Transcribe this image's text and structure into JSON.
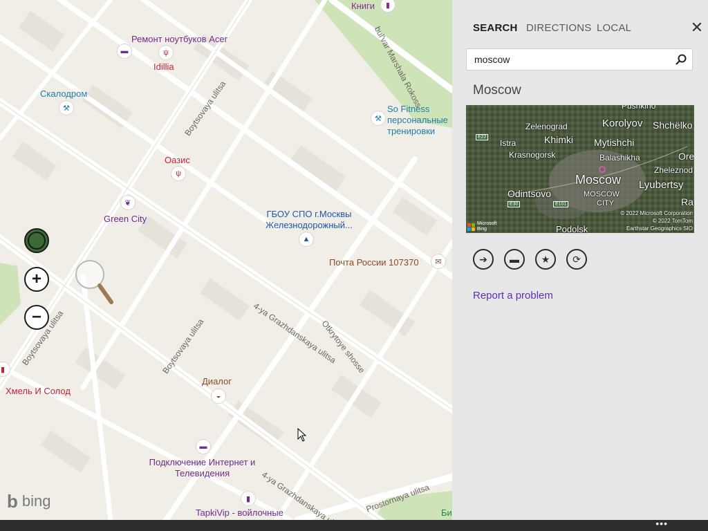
{
  "tabs": [
    "SEARCH",
    "DIRECTIONS",
    "LOCAL"
  ],
  "search": {
    "value": "moscow"
  },
  "result": {
    "title": "Moscow",
    "report_link": "Report a problem",
    "thumbnail": {
      "places": [
        "Pushkino",
        "Zelenograd",
        "Korolyov",
        "Shchëlko",
        "Khimki",
        "Mytishchi",
        "Istra",
        "Krasnogorsk",
        "Balashikha",
        "Ore",
        "Zheleznod",
        "Moscow",
        "Odintsovo",
        "Lyubertsy",
        "MOSCOW",
        "CITY",
        "Ra",
        "Podolsk"
      ],
      "route_shields": [
        "E22",
        "E30",
        "E101"
      ],
      "credits": [
        "© 2022 Microsoft Corporation",
        "© 2022 TomTom",
        "Earthstar Geographics SIO"
      ],
      "logo": [
        "Microsoft",
        "Bing"
      ]
    }
  },
  "map": {
    "poi": [
      {
        "label": "Книги",
        "icon": "book-icon",
        "color": "#8a2e8e"
      },
      {
        "label": "Ремонт ноутбуков Acer",
        "icon": "laptop-icon",
        "color": "#6d2b8c"
      },
      {
        "label": "Idillia",
        "icon": "restaurant-icon",
        "color": "#c0233a"
      },
      {
        "label": "Скалодром",
        "icon": "fitness-icon",
        "color": "#1d7ea8"
      },
      {
        "label": "So Fitness персональные тренировки",
        "icon": "fitness-icon",
        "color": "#1d7ea8"
      },
      {
        "label": "Оазис",
        "icon": "restaurant-icon",
        "color": "#c0233a"
      },
      {
        "label": "Green City",
        "icon": "leaf-icon",
        "color": "#6d2b8c"
      },
      {
        "label": "ГБОУ СПО г.Москвы Железнодорожный...",
        "icon": "school-icon",
        "color": "#1f55a8"
      },
      {
        "label": "Почта России 107370",
        "icon": "mail-icon",
        "color": "#8a4a22"
      },
      {
        "label": "Диалог",
        "icon": "bowl-icon",
        "color": "#8a4a22"
      },
      {
        "label": "Хмель И Солод",
        "icon": "shopping-icon",
        "color": "#c0233a"
      },
      {
        "label": "Подключение Интернет и Телевидения",
        "icon": "laptop-icon",
        "color": "#6d2b8c"
      },
      {
        "label": "TapkiVip - войлочные",
        "icon": "shopping-bag-icon",
        "color": "#6d2b8c"
      },
      {
        "label": "Би",
        "icon": "",
        "color": "#1f8a4a"
      }
    ],
    "streets": [
      "bul'var Marshala Rokoss",
      "Boytsovaya ulitsa",
      "Boytsovaya ulitsa",
      "Boytsovaya ulitsa",
      "4-ya Grazhdanskaya ulitsa",
      "Otkrytoye shosse",
      "4-ya Grazhdanskaya ulitsa",
      "Prostornaya ulitsa"
    ],
    "brand": "bing"
  },
  "colors": {
    "accent": "#5b2fb5",
    "panel_bg": "#e7e7e7",
    "appbar": "#2d2d2d",
    "map_bg": "#f1eee8",
    "park": "#cfe3b8"
  },
  "appbar": {
    "more": "•••"
  }
}
